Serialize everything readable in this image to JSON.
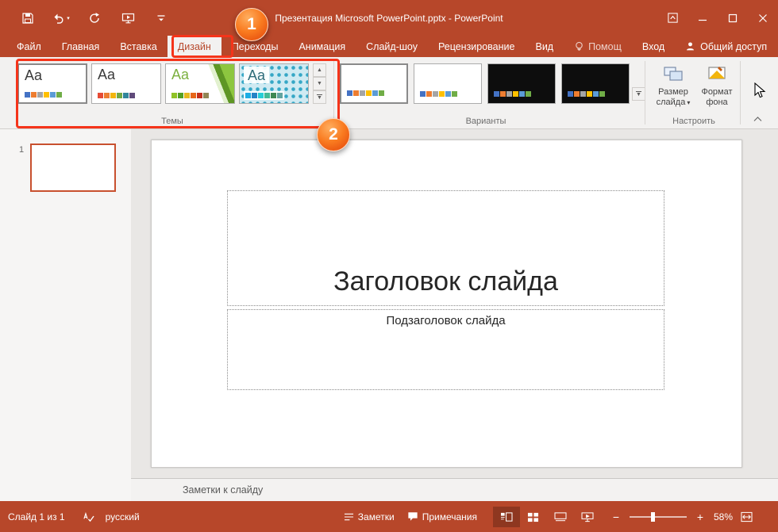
{
  "accent_color": "#B7472A",
  "annotation_color": "#F5341A",
  "titlebar": {
    "title": "Презентация Microsoft PowerPoint.pptx - PowerPoint"
  },
  "tabs": {
    "file": "Файл",
    "home": "Главная",
    "insert": "Вставка",
    "design": "Дизайн",
    "transitions": "Переходы",
    "animations": "Анимация",
    "slideshow": "Слайд-шоу",
    "review": "Рецензирование",
    "view": "Вид",
    "help": "Помощ",
    "signin": "Вход",
    "share": "Общий доступ"
  },
  "ribbon": {
    "themes": {
      "label": "Темы",
      "aa": "Aa",
      "items": [
        {
          "name": "office",
          "colors": [
            "#4472C4",
            "#ED7D31",
            "#A5A5A5",
            "#FFC000",
            "#5B9BD5",
            "#70AD47"
          ]
        },
        {
          "name": "theme-2",
          "colors": [
            "#E64B35",
            "#ED7D31",
            "#F2B50C",
            "#71A845",
            "#31859B",
            "#604A7B"
          ]
        },
        {
          "name": "facet",
          "colors": [
            "#90C226",
            "#54A021",
            "#E6B91E",
            "#E76618",
            "#C42F1A",
            "#918655"
          ]
        },
        {
          "name": "integral",
          "colors": [
            "#1CADE4",
            "#2683C6",
            "#27CED7",
            "#42BA97",
            "#3E8853",
            "#62A39F"
          ]
        }
      ]
    },
    "variants": {
      "label": "Варианты",
      "items": [
        {
          "style": "light",
          "colors": [
            "#4472C4",
            "#ED7D31",
            "#A5A5A5",
            "#FFC000",
            "#5B9BD5",
            "#70AD47"
          ]
        },
        {
          "style": "light",
          "colors": [
            "#4472C4",
            "#ED7D31",
            "#A5A5A5",
            "#FFC000",
            "#5B9BD5",
            "#70AD47"
          ]
        },
        {
          "style": "dark",
          "colors": [
            "#4472C4",
            "#ED7D31",
            "#A5A5A5",
            "#FFC000",
            "#5B9BD5",
            "#70AD47"
          ]
        },
        {
          "style": "dark",
          "colors": [
            "#4472C4",
            "#ED7D31",
            "#A5A5A5",
            "#FFC000",
            "#5B9BD5",
            "#70AD47"
          ]
        }
      ]
    },
    "customize": {
      "label": "Настроить",
      "slide_size_line1": "Размер",
      "slide_size_line2": "слайда",
      "format_bg_line1": "Формат",
      "format_bg_line2": "фона"
    }
  },
  "icons": {
    "caret_down": "▾",
    "gallery_up": "▲",
    "gallery_down": "▼",
    "zoom_out": "−",
    "zoom_in": "+"
  },
  "slide_panel": {
    "slide_number": "1"
  },
  "slide": {
    "title_placeholder": "Заголовок слайда",
    "subtitle_placeholder": "Подзаголовок слайда"
  },
  "notes": {
    "label": "Заметки к слайду"
  },
  "statusbar": {
    "slide_info": "Слайд 1 из 1",
    "language": "русский",
    "notes_button": "Заметки",
    "comments_button": "Примечания",
    "zoom_level": "58%"
  },
  "annotations": {
    "step_1": "1",
    "step_2": "2"
  }
}
